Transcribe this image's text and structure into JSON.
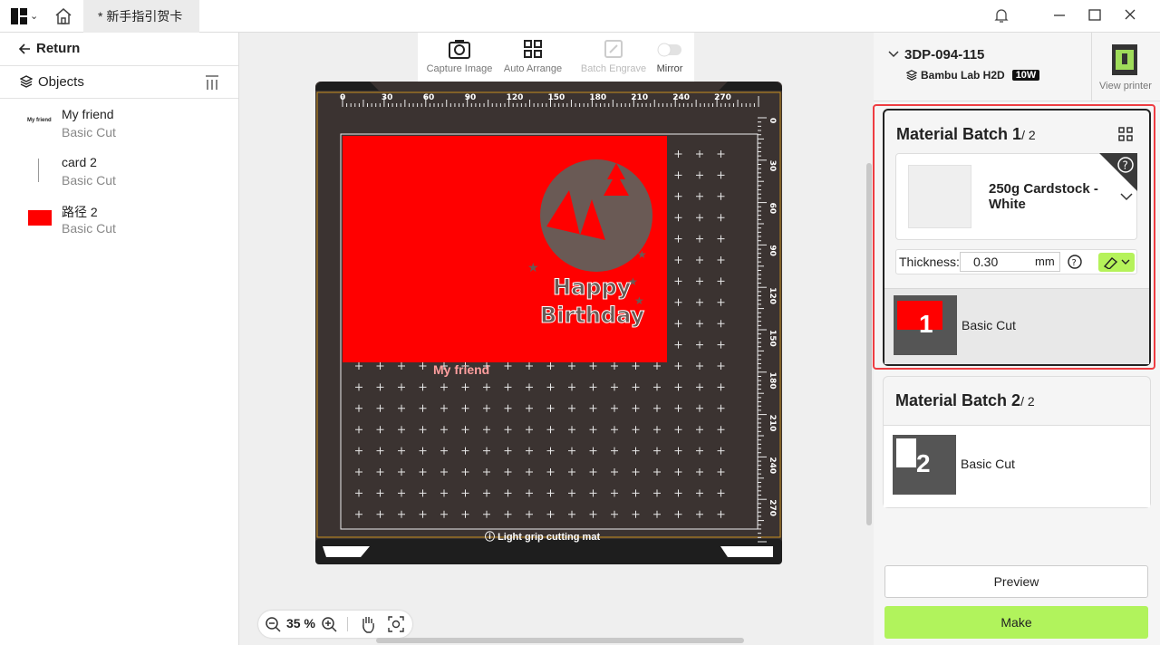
{
  "titlebar": {
    "tab_label": "* 新手指引贺卡"
  },
  "left": {
    "return_label": "Return",
    "objects_label": "Objects",
    "objects": [
      {
        "name": "My friend",
        "type": "Basic Cut"
      },
      {
        "name": "card 2",
        "type": "Basic Cut"
      },
      {
        "name": "路径 2",
        "type": "Basic Cut"
      }
    ]
  },
  "toolbar": {
    "capture": "Capture Image",
    "arrange": "Auto Arrange",
    "engrave": "Batch Engrave",
    "mirror": "Mirror"
  },
  "mat": {
    "ruler_top": [
      "0",
      "30",
      "60",
      "90",
      "120",
      "150",
      "180",
      "210",
      "240",
      "270"
    ],
    "ruler_right": [
      "0",
      "30",
      "60",
      "90",
      "120",
      "150",
      "180",
      "210",
      "240",
      "270"
    ],
    "label": "Light grip cutting mat",
    "card_text": "My friend"
  },
  "zoom": {
    "value": "35 %"
  },
  "printer": {
    "name": "3DP-094-115",
    "model": "Bambu Lab H2D",
    "laser": "10W",
    "view_label": "View printer"
  },
  "batch1": {
    "title": "Material Batch 1",
    "count": "/ 2",
    "material": "250g Cardstock - White",
    "thickness_label": "Thickness:",
    "thickness_value": "0.30",
    "unit": "mm",
    "cut_label": "Basic Cut",
    "cut_number": "1"
  },
  "batch2": {
    "title": "Material Batch 2",
    "count": "/ 2",
    "cut_label": "Basic Cut",
    "cut_number": "2"
  },
  "actions": {
    "preview": "Preview",
    "make": "Make"
  },
  "colors": {
    "accent": "#b1f35c",
    "highlight": "#ee3d42",
    "card": "#ff0000",
    "mat": "#3b3331"
  }
}
